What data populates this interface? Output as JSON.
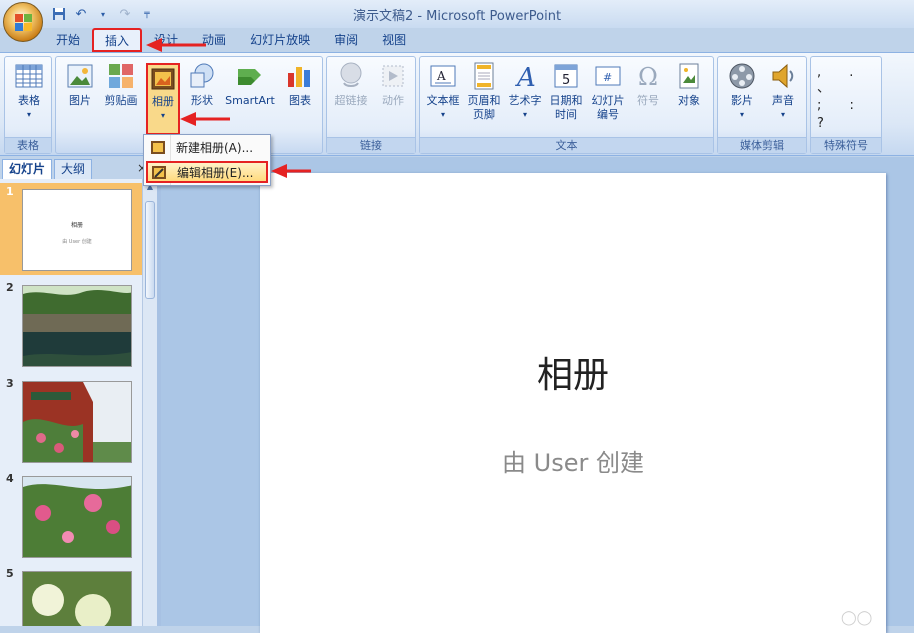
{
  "window": {
    "title": "演示文稿2 - Microsoft PowerPoint"
  },
  "qat": {
    "save_icon": "save-icon",
    "undo_icon": "undo-icon",
    "redo_icon": "redo-icon",
    "customize_icon": "customize-icon"
  },
  "tabs": [
    {
      "label": "开始"
    },
    {
      "label": "插入"
    },
    {
      "label": "设计"
    },
    {
      "label": "动画"
    },
    {
      "label": "幻灯片放映"
    },
    {
      "label": "审阅"
    },
    {
      "label": "视图"
    }
  ],
  "ribbon": {
    "groups": {
      "tables": {
        "label": "表格",
        "table": "表格"
      },
      "illustrations": {
        "picture": "图片",
        "clipart": "剪贴画",
        "album": "相册",
        "shapes": "形状",
        "smartart": "SmartArt",
        "chart": "图表"
      },
      "links": {
        "label": "链接",
        "hyperlink": "超链接",
        "action": "动作"
      },
      "text": {
        "label": "文本",
        "textbox": "文本框",
        "header_footer": [
          "页眉和",
          "页脚"
        ],
        "wordart": "艺术字",
        "datetime": [
          "日期和",
          "时间"
        ],
        "slide_number": [
          "幻灯片",
          "编号"
        ],
        "symbol": "符号",
        "object": "对象"
      },
      "media": {
        "label": "媒体剪辑",
        "movie": "影片",
        "sound": "声音"
      },
      "special": {
        "label": "特殊符号",
        "symbol": "符号"
      }
    }
  },
  "album_menu": {
    "items": [
      {
        "label": "新建相册(A)..."
      },
      {
        "label": "编辑相册(E)..."
      }
    ]
  },
  "pane": {
    "tab_slides": "幻灯片",
    "tab_outline": "大纲",
    "close": "×"
  },
  "thumbnails": [
    {
      "num": "1",
      "title": "相册",
      "subtitle": "由 User 创建"
    },
    {
      "num": "2"
    },
    {
      "num": "3"
    },
    {
      "num": "4"
    },
    {
      "num": "5"
    }
  ],
  "slide": {
    "title": "相册",
    "subtitle": "由 User 创建"
  },
  "colors": {
    "annotation_red": "#e52222",
    "ribbon_blue": "#15428b"
  }
}
